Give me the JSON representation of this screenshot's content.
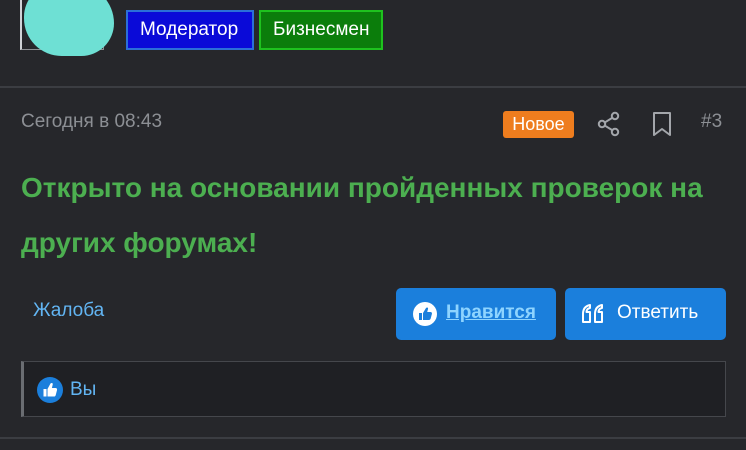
{
  "user": {
    "roles": [
      "Модератор",
      "Бизнесмен"
    ],
    "role_colors": [
      "#0a0ad8",
      "#0b7d0b"
    ]
  },
  "post": {
    "date": "Сегодня в 08:43",
    "new_badge": "Новое",
    "number": "#3",
    "text": "Открыто на основании пройденных проверок на других форумах!",
    "text_color": "#4caf50"
  },
  "actions": {
    "report": "Жалоба",
    "like": "Нравится",
    "reply": "Ответить",
    "accent": "#1b7fdc"
  },
  "reactions": {
    "users": "Вы"
  }
}
